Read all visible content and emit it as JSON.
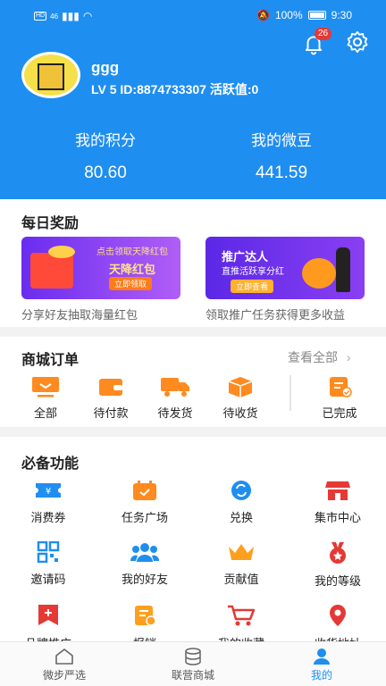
{
  "status_bar": {
    "network": "HD",
    "signal_label": "46",
    "battery": "100%",
    "time": "9:30"
  },
  "notifications": {
    "count": "26"
  },
  "user": {
    "name": "ggg",
    "info": "LV 5  ID:8874733307  活跃值:0"
  },
  "stats": [
    {
      "label": "我的积分",
      "value": "80.60"
    },
    {
      "label": "我的微豆",
      "value": "441.59"
    }
  ],
  "daily_rewards": {
    "title": "每日奖励",
    "promos": [
      {
        "line1": "点击领取天降红包",
        "line2": "天降红包",
        "button": "立即领取",
        "caption": "分享好友抽取海量红包"
      },
      {
        "line1": "推广达人",
        "line2": "直推活跃享分红",
        "button": "立即查看",
        "caption": "领取推广任务获得更多收益"
      }
    ]
  },
  "orders": {
    "title": "商城订单",
    "view_all": "查看全部",
    "items": [
      {
        "label": "全部",
        "icon": "monitor-icon"
      },
      {
        "label": "待付款",
        "icon": "wallet-icon"
      },
      {
        "label": "待发货",
        "icon": "truck-icon"
      },
      {
        "label": "待收货",
        "icon": "box-icon"
      },
      {
        "label": "已完成",
        "icon": "completed-icon"
      }
    ]
  },
  "functions": {
    "title": "必备功能",
    "items": [
      {
        "label": "消费券",
        "icon": "coupon-icon",
        "color": "#1f8ef1"
      },
      {
        "label": "任务广场",
        "icon": "calendar-icon",
        "color": "#ff8a1f"
      },
      {
        "label": "兑换",
        "icon": "exchange-icon",
        "color": "#1f8ef1"
      },
      {
        "label": "集市中心",
        "icon": "store-icon",
        "color": "#e53935"
      },
      {
        "label": "邀请码",
        "icon": "qrcode-icon",
        "color": "#1f8ef1"
      },
      {
        "label": "我的好友",
        "icon": "friends-icon",
        "color": "#1f8ef1"
      },
      {
        "label": "贡献值",
        "icon": "crown-icon",
        "color": "#ff9f1f"
      },
      {
        "label": "我的等级",
        "icon": "medal-icon",
        "color": "#e53935"
      },
      {
        "label": "品牌推广",
        "icon": "flag-icon",
        "color": "#e53935"
      },
      {
        "label": "报销",
        "icon": "receipt-icon",
        "color": "#ff9f1f"
      },
      {
        "label": "我的收藏",
        "icon": "cart-icon",
        "color": "#e53935"
      },
      {
        "label": "收货地址",
        "icon": "location-icon",
        "color": "#e53935"
      }
    ]
  },
  "tabbar": [
    {
      "label": "微步严选",
      "icon": "home-icon"
    },
    {
      "label": "联营商城",
      "icon": "database-icon"
    },
    {
      "label": "我的",
      "icon": "person-icon"
    }
  ],
  "colors": {
    "primary": "#1f8ef1",
    "accent_orange": "#ff8a1f",
    "accent_red": "#e53935"
  }
}
